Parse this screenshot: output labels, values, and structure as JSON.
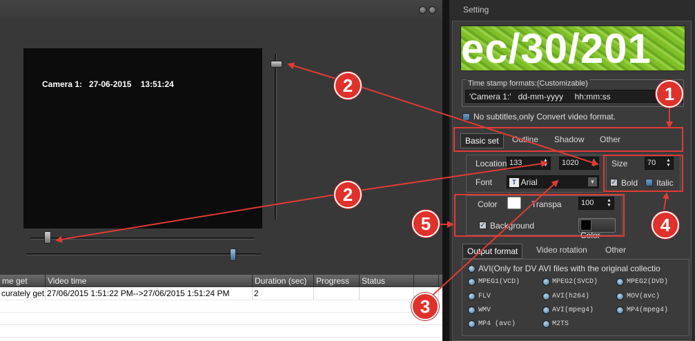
{
  "preview": {
    "overlay_text": "Camera 1:   27-06-2015    13:51:24"
  },
  "table": {
    "columns": [
      "me get",
      "Video time",
      "Duration (sec)",
      "Progress",
      "Status",
      ""
    ],
    "rows": [
      [
        "curately get",
        "27/06/2015 1:51:22 PM-->27/06/2015 1:51:24 PM",
        "2",
        "",
        "",
        ""
      ]
    ]
  },
  "settings": {
    "window_title": "Setting",
    "banner_text": "ec/30/201",
    "timestamp_label": "Time stamp formats:(Customizable)",
    "timestamp_value": "'Camera 1:'   dd-mm-yyyy     hh:mm:ss",
    "no_subtitles_label": "No subtitles,only Convert video format.",
    "style_tabs": [
      "Basic set",
      "Outline",
      "Shadow",
      "Other"
    ],
    "location_label": "Location",
    "location_x": "133",
    "location_y": "1020",
    "size_label": "Size",
    "size_value": "70",
    "bold_label": "Bold",
    "italic_label": "Italic",
    "font_label": "Font",
    "font_value": "Arial",
    "color_label": "Color",
    "transparency_label": "Transpa",
    "transparency_value": "100",
    "background_label": "Background",
    "color_button_label": "Color",
    "colors": {
      "text_color": "#ffffff",
      "background_color": "#000000",
      "annotation": "#e0312b"
    },
    "output_tabs": [
      "Output format",
      "Video rotation",
      "Other"
    ],
    "formats": {
      "avi_dv": "AVI(Only for DV AVI files with the original collectio",
      "mpeg1": "MPEG1(VCD)",
      "mpeg2_svcd": "MPEG2(SVCD)",
      "mpeg2_dvd": "MPEG2(DVD)",
      "flv": "FLV",
      "avi_h264": "AVI(h264)",
      "mov_avc": "MOV(avc)",
      "wmv": "WMV",
      "avi_mpeg4": "AVI(mpeg4)",
      "mp4_mpeg4": "MP4(mpeg4)",
      "mp4_avc": "MP4 (avc)",
      "m2ts": "M2TS"
    }
  },
  "annotations": {
    "c1": "1",
    "c2a": "2",
    "c2b": "2",
    "c3": "3",
    "c4": "4",
    "c5": "5"
  }
}
